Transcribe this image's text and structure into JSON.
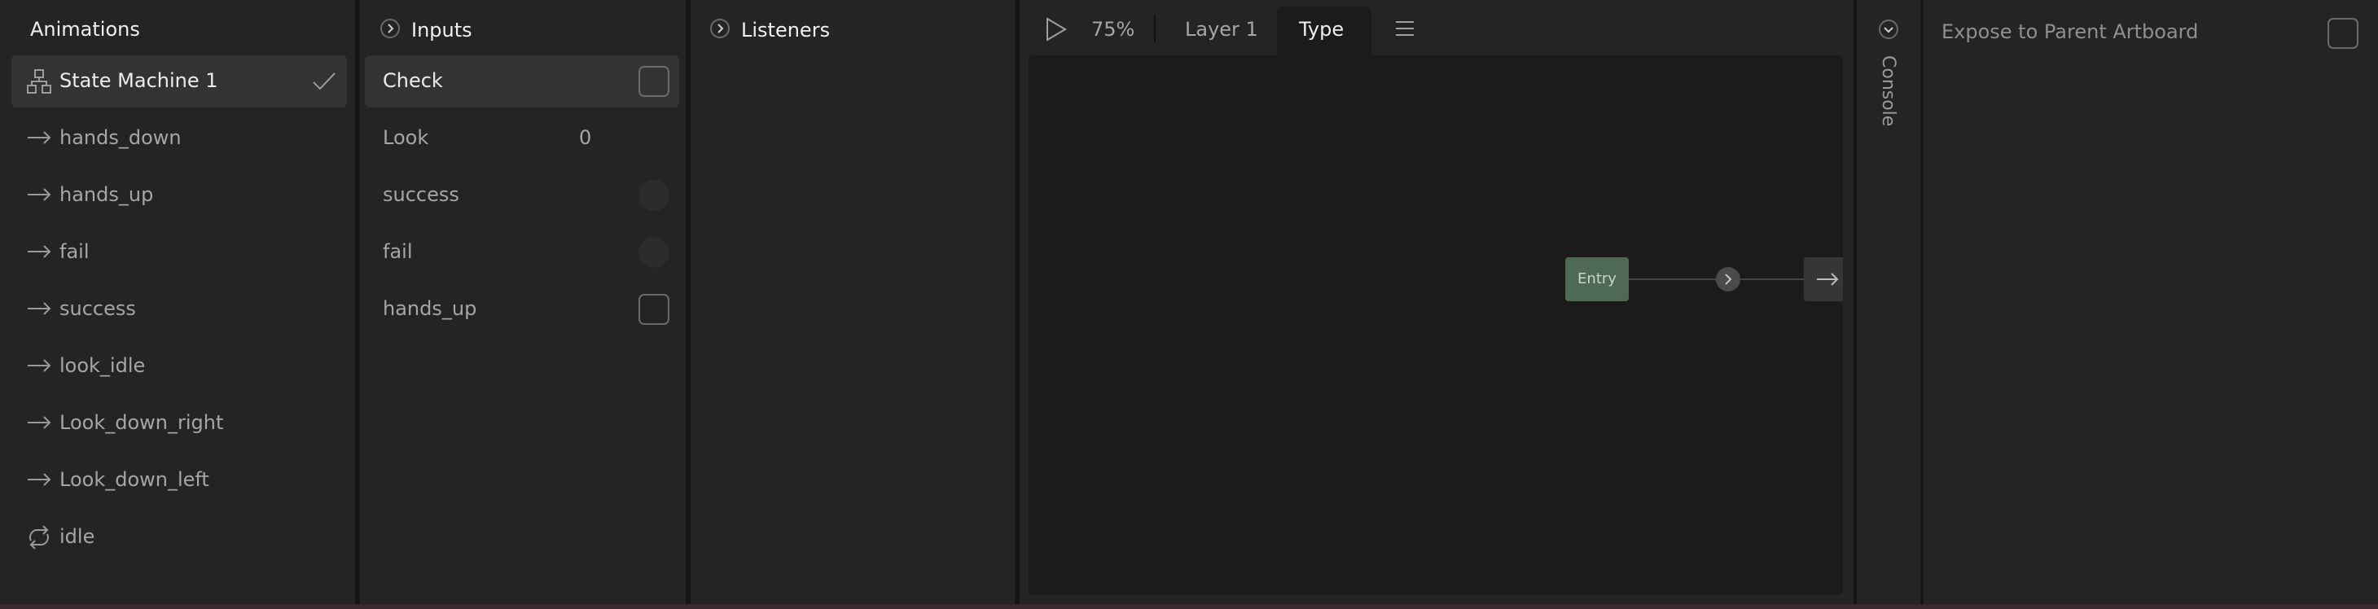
{
  "animations": {
    "title": "Animations",
    "state_machine": "State Machine 1",
    "items": [
      {
        "label": "hands_down",
        "icon": "arrow-right-icon"
      },
      {
        "label": "hands_up",
        "icon": "arrow-right-icon"
      },
      {
        "label": "fail",
        "icon": "arrow-right-icon"
      },
      {
        "label": "success",
        "icon": "arrow-right-icon"
      },
      {
        "label": "look_idle",
        "icon": "arrow-right-icon"
      },
      {
        "label": "Look_down_right",
        "icon": "arrow-right-icon"
      },
      {
        "label": "Look_down_left",
        "icon": "arrow-right-icon"
      },
      {
        "label": "idle",
        "icon": "loop-icon"
      }
    ]
  },
  "inputs": {
    "title": "Inputs",
    "items": [
      {
        "label": "Check",
        "type": "boolean"
      },
      {
        "label": "Look",
        "type": "number",
        "value": "0"
      },
      {
        "label": "success",
        "type": "trigger"
      },
      {
        "label": "fail",
        "type": "trigger"
      },
      {
        "label": "hands_up",
        "type": "boolean"
      }
    ]
  },
  "listeners": {
    "title": "Listeners"
  },
  "graph": {
    "zoom": "75%",
    "tabs": [
      "Layer 1",
      "Type"
    ],
    "entry_label": "Entry"
  },
  "console": {
    "label": "Console"
  },
  "properties": {
    "expose_label": "Expose to Parent Artboard"
  },
  "colors": {
    "panel": "#242424",
    "canvas": "#1a1a1a",
    "entry_node": "#4e6a55",
    "selected_row": "#333333"
  }
}
